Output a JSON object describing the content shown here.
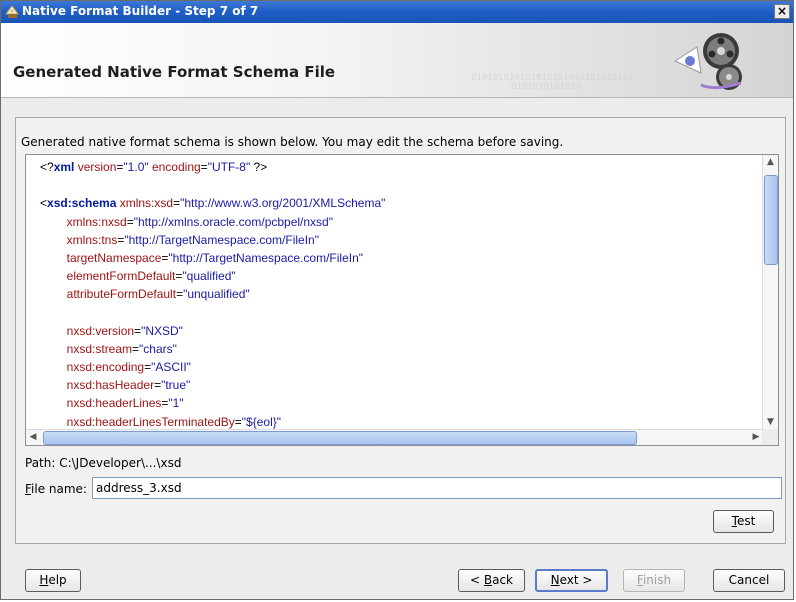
{
  "window": {
    "title": "Native Format Builder - Step 7 of 7",
    "close_label": "×"
  },
  "header": {
    "title": "Generated Native Format Schema File",
    "binary_text_1": "010101010101010101010101010101",
    "binary_text_2": "0101010101010"
  },
  "instruction": "Generated native format schema is shown below. You may edit the schema before saving.",
  "schema_lines": [
    {
      "indent": "",
      "parts": [
        {
          "cls": "pi",
          "text": "<?"
        },
        {
          "cls": "kw",
          "text": "xml"
        },
        {
          "cls": "attr",
          "text": " version"
        },
        {
          "cls": "pi",
          "text": "="
        },
        {
          "cls": "val",
          "text": "\"1.0\""
        },
        {
          "cls": "attr",
          "text": " encoding"
        },
        {
          "cls": "pi",
          "text": "="
        },
        {
          "cls": "val",
          "text": "\"UTF-8\""
        },
        {
          "cls": "pi",
          "text": " ?>"
        }
      ]
    },
    {
      "indent": "",
      "parts": []
    },
    {
      "indent": "",
      "parts": [
        {
          "cls": "pi",
          "text": "<"
        },
        {
          "cls": "kw",
          "text": "xsd:schema"
        },
        {
          "cls": "attr",
          "text": " xmlns:xsd"
        },
        {
          "cls": "pi",
          "text": "="
        },
        {
          "cls": "val",
          "text": "\"http://www.w3.org/2001/XMLSchema\""
        }
      ]
    },
    {
      "indent": "        ",
      "parts": [
        {
          "cls": "attr",
          "text": "xmlns:nxsd"
        },
        {
          "cls": "pi",
          "text": "="
        },
        {
          "cls": "val",
          "text": "\"http://xmlns.oracle.com/pcbpel/nxsd\""
        }
      ]
    },
    {
      "indent": "        ",
      "parts": [
        {
          "cls": "attr",
          "text": "xmlns:tns"
        },
        {
          "cls": "pi",
          "text": "="
        },
        {
          "cls": "val",
          "text": "\"http://TargetNamespace.com/FileIn\""
        }
      ]
    },
    {
      "indent": "        ",
      "parts": [
        {
          "cls": "attr",
          "text": "targetNamespace"
        },
        {
          "cls": "pi",
          "text": "="
        },
        {
          "cls": "val",
          "text": "\"http://TargetNamespace.com/FileIn\""
        }
      ]
    },
    {
      "indent": "        ",
      "parts": [
        {
          "cls": "attr",
          "text": "elementFormDefault"
        },
        {
          "cls": "pi",
          "text": "="
        },
        {
          "cls": "val",
          "text": "\"qualified\""
        }
      ]
    },
    {
      "indent": "        ",
      "parts": [
        {
          "cls": "attr",
          "text": "attributeFormDefault"
        },
        {
          "cls": "pi",
          "text": "="
        },
        {
          "cls": "val",
          "text": "\"unqualified\""
        }
      ]
    },
    {
      "indent": "",
      "parts": []
    },
    {
      "indent": "        ",
      "parts": [
        {
          "cls": "attr",
          "text": "nxsd:version"
        },
        {
          "cls": "pi",
          "text": "="
        },
        {
          "cls": "val",
          "text": "\"NXSD\""
        }
      ]
    },
    {
      "indent": "        ",
      "parts": [
        {
          "cls": "attr",
          "text": "nxsd:stream"
        },
        {
          "cls": "pi",
          "text": "="
        },
        {
          "cls": "val",
          "text": "\"chars\""
        }
      ]
    },
    {
      "indent": "        ",
      "parts": [
        {
          "cls": "attr",
          "text": "nxsd:encoding"
        },
        {
          "cls": "pi",
          "text": "="
        },
        {
          "cls": "val",
          "text": "\"ASCII\""
        }
      ]
    },
    {
      "indent": "        ",
      "parts": [
        {
          "cls": "attr",
          "text": "nxsd:hasHeader"
        },
        {
          "cls": "pi",
          "text": "="
        },
        {
          "cls": "val",
          "text": "\"true\""
        }
      ]
    },
    {
      "indent": "        ",
      "parts": [
        {
          "cls": "attr",
          "text": "nxsd:headerLines"
        },
        {
          "cls": "pi",
          "text": "="
        },
        {
          "cls": "val",
          "text": "\"1\""
        }
      ]
    },
    {
      "indent": "        ",
      "parts": [
        {
          "cls": "attr",
          "text": "nxsd:headerLinesTerminatedBy"
        },
        {
          "cls": "pi",
          "text": "="
        },
        {
          "cls": "val",
          "text": "\"${eol}\""
        }
      ]
    }
  ],
  "path_label": "Path: C:\\JDeveloper\\...\\xsd",
  "file_name": {
    "label_mnemonic": "F",
    "label_rest": "ile name:",
    "value": "address_3.xsd"
  },
  "buttons": {
    "test": {
      "mnemonic": "T",
      "rest": "est"
    },
    "help": {
      "mnemonic": "H",
      "rest": "elp"
    },
    "back": {
      "prefix": "< ",
      "mnemonic": "B",
      "rest": "ack"
    },
    "next": {
      "mnemonic": "N",
      "rest": "ext >"
    },
    "finish": {
      "mnemonic": "F",
      "rest": "inish"
    },
    "cancel": "Cancel"
  },
  "colors": {
    "titlebar": "#1f5fc8",
    "xml_keyword": "#001a9e",
    "xml_attribute": "#a01414",
    "xml_value": "#1a1aa6"
  }
}
